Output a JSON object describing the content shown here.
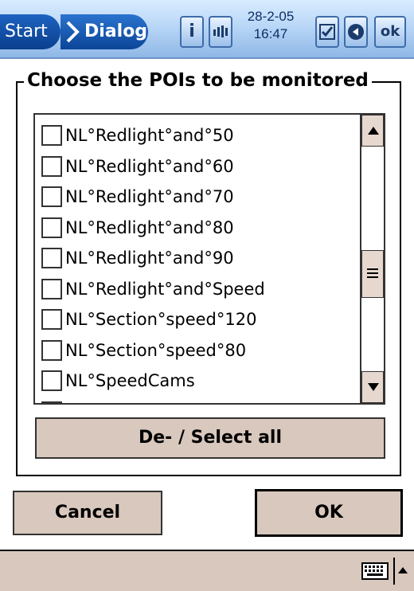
{
  "topbar": {
    "start_label": "Start",
    "title": "Dialog",
    "clock_date": "28-2-05",
    "clock_time": "16:47",
    "icons": [
      "info-icon",
      "volume-icon",
      "checklist-icon",
      "back-arrow-icon",
      "ok-icon"
    ],
    "ok_label": "ok"
  },
  "dialog": {
    "group_title": "Choose the POIs to be monitored",
    "items": [
      "NL°Redlight°and°50",
      "NL°Redlight°and°60",
      "NL°Redlight°and°70",
      "NL°Redlight°and°80",
      "NL°Redlight°and°90",
      "NL°Redlight°and°Speed",
      "NL°Section°speed°120",
      "NL°Section°speed°80",
      "NL°SpeedCams"
    ],
    "select_all_label": "De- / Select all",
    "cancel_label": "Cancel",
    "ok_label": "OK"
  },
  "bottombar": {
    "icons": [
      "keyboard-icon",
      "sip-up-arrow-icon"
    ]
  },
  "colors": {
    "topbar": "#b9d7f7",
    "start": "#0a3f8d",
    "button": "#d9c8bd"
  }
}
